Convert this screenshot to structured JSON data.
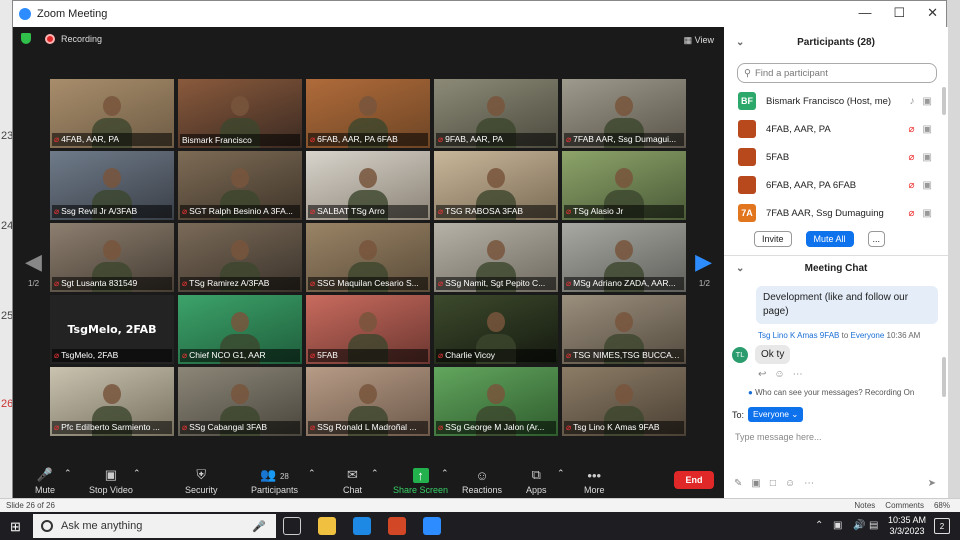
{
  "window": {
    "title": "Zoom Meeting",
    "recording_label": "Recording",
    "view_label": "View"
  },
  "bg_rulers": [
    "23",
    "24",
    "25",
    "26"
  ],
  "page_indicator": "1/2",
  "tiles": [
    {
      "name": "4FAB, AAR, PA",
      "muted": true,
      "c1": "#a88d6b",
      "c2": "#6e5c45"
    },
    {
      "name": "Bismark Francisco",
      "muted": false,
      "c1": "#8a5a3c",
      "c2": "#3b2a22"
    },
    {
      "name": "6FAB, AAR, PA 6FAB",
      "muted": true,
      "c1": "#b06b3a",
      "c2": "#6d4525"
    },
    {
      "name": "9FAB, AAR, PA",
      "muted": true,
      "c1": "#8c8a77",
      "c2": "#4c4b3e"
    },
    {
      "name": "7FAB AAR, Ssg Dumagui...",
      "muted": true,
      "c1": "#9e9a8c",
      "c2": "#5a544a"
    },
    {
      "name": "Ssg Revil Jr A/3FAB",
      "muted": true,
      "c1": "#6f7b8a",
      "c2": "#3a3f47"
    },
    {
      "name": "SGT Ralph Besinio A 3FA...",
      "muted": true,
      "c1": "#7d6b55",
      "c2": "#3f352a"
    },
    {
      "name": "SALBAT TSg Arro",
      "muted": true,
      "c1": "#d8d4cc",
      "c2": "#8c8376"
    },
    {
      "name": "TSG RABOSA  3FAB",
      "muted": true,
      "c1": "#c9b79a",
      "c2": "#7a6b55"
    },
    {
      "name": "TSg Alasio Jr",
      "muted": true,
      "c1": "#8da46a",
      "c2": "#4a5a37"
    },
    {
      "name": "Sgt Lusanta 831549",
      "muted": true,
      "c1": "#8d7f70",
      "c2": "#463d33"
    },
    {
      "name": "TSg Ramirez A/3FAB",
      "muted": true,
      "c1": "#7a6a58",
      "c2": "#3b332b"
    },
    {
      "name": "SSG Maquilan Cesario S...",
      "muted": true,
      "c1": "#9a8466",
      "c2": "#5b4c39"
    },
    {
      "name": "SSg Namit, Sgt Pepito C...",
      "muted": true,
      "c1": "#b7b2a8",
      "c2": "#6f6a60"
    },
    {
      "name": "MSg Adriano ZADA, AAR...",
      "muted": true,
      "c1": "#a8a9a3",
      "c2": "#5f605b"
    },
    {
      "name": "TsgMelo, 2FAB",
      "muted": true,
      "textonly": true,
      "big": "TsgMelo, 2FAB"
    },
    {
      "name": "Chief NCO G1, AAR",
      "muted": true,
      "c1": "#3ca36a",
      "c2": "#1f5e3c"
    },
    {
      "name": "5FAB",
      "muted": true,
      "c1": "#c96b5e",
      "c2": "#6b3630"
    },
    {
      "name": "Charlie Vicoy",
      "muted": true,
      "c1": "#3d4a2c",
      "c2": "#151a10"
    },
    {
      "name": "TSG NIMES,TSG BUCCAT...",
      "muted": true,
      "c1": "#9b8f7d",
      "c2": "#544b3f"
    },
    {
      "name": "Pfc Edilberto Sarmiento ...",
      "muted": true,
      "active": true,
      "c1": "#c9c3b0",
      "c2": "#77705f"
    },
    {
      "name": "SSg Cabangal 3FAB",
      "muted": true,
      "c1": "#8c8678",
      "c2": "#4a463d"
    },
    {
      "name": "SSg Ronald L Madroñal ...",
      "muted": true,
      "c1": "#b79c87",
      "c2": "#6c5849"
    },
    {
      "name": "SSg George M Jalon (Ar...",
      "muted": true,
      "c1": "#62a65e",
      "c2": "#2f5c2d"
    },
    {
      "name": "Tsg Lino K Amas 9FAB",
      "muted": true,
      "c1": "#8c7c66",
      "c2": "#4a4034"
    }
  ],
  "toolbar": {
    "mute": "Mute",
    "stop_video": "Stop Video",
    "security": "Security",
    "participants": "Participants",
    "participants_count": "28",
    "chat": "Chat",
    "share_screen": "Share Screen",
    "reactions": "Reactions",
    "apps": "Apps",
    "more": "More",
    "end": "End"
  },
  "panel": {
    "participants_title": "Participants (28)",
    "search_placeholder": "Find a participant",
    "participants": [
      {
        "initials": "BF",
        "color": "#2da86b",
        "name": "Bismark Francisco (Host, me)"
      },
      {
        "initials": "",
        "color": "#b8491d",
        "name": "4FAB, AAR, PA"
      },
      {
        "initials": "",
        "color": "#b8491d",
        "name": "5FAB"
      },
      {
        "initials": "",
        "color": "#b8491d",
        "name": "6FAB, AAR, PA 6FAB"
      },
      {
        "initials": "7A",
        "color": "#e2761e",
        "name": "7FAB AAR, Ssg Dumaguing"
      }
    ],
    "invite": "Invite",
    "mute_all": "Mute All",
    "more_dots": "...",
    "chat_title": "Meeting Chat",
    "prev_message": "Development (like and follow our page)",
    "sender": "Tsg Lino K Amas 9FAB",
    "to_word": "to",
    "recipient": "Everyone",
    "time": "10:36 AM",
    "sender_initials": "TL",
    "message": "Ok ty",
    "who_can_see": "Who can see your messages? Recording On",
    "to_label": "To:",
    "to_value": "Everyone",
    "input_placeholder": "Type message here..."
  },
  "pptbar": {
    "slide": "Slide 26 of 26",
    "notes": "Notes",
    "comments": "Comments",
    "zoom": "68%"
  },
  "taskbar": {
    "search": "Ask me anything",
    "time": "10:35 AM",
    "date": "3/3/2023",
    "notif_count": "2"
  }
}
